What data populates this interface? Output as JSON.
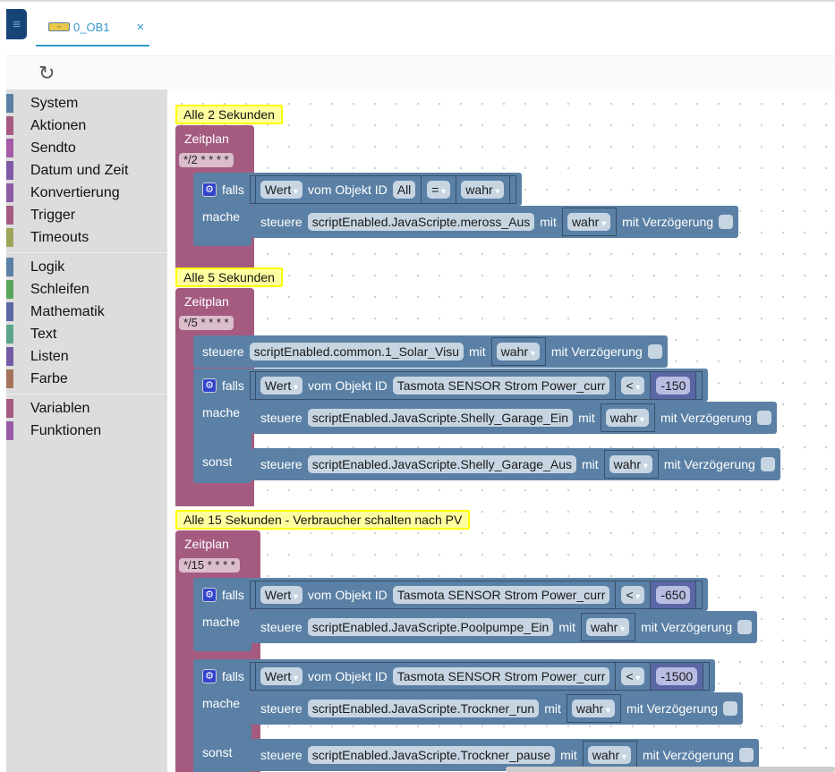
{
  "tab": {
    "label": "0_OB1",
    "close": "×",
    "icon": "script-block-icon"
  },
  "toolbar": {
    "refresh_icon": "refresh-icon"
  },
  "menu_icon": "hamburger-icon",
  "sidebar": {
    "groups": [
      [
        {
          "label": "System",
          "color": "#5b80a5"
        },
        {
          "label": "Aktionen",
          "color": "#a55b80"
        },
        {
          "label": "Sendto",
          "color": "#a55ba5"
        },
        {
          "label": "Datum und Zeit",
          "color": "#805ba5"
        },
        {
          "label": "Konvertierung",
          "color": "#8e5ba5"
        },
        {
          "label": "Trigger",
          "color": "#a55b80"
        },
        {
          "label": "Timeouts",
          "color": "#9fa55b"
        }
      ],
      [
        {
          "label": "Logik",
          "color": "#5b80a5"
        },
        {
          "label": "Schleifen",
          "color": "#5ba55b"
        },
        {
          "label": "Mathematik",
          "color": "#5b67a5"
        },
        {
          "label": "Text",
          "color": "#5ba58c"
        },
        {
          "label": "Listen",
          "color": "#745ba5"
        },
        {
          "label": "Farbe",
          "color": "#a5745b"
        }
      ],
      [
        {
          "label": "Variablen",
          "color": "#a55b80"
        },
        {
          "label": "Funktionen",
          "color": "#995ba5"
        }
      ]
    ]
  },
  "labels": {
    "schedule": "Zeitplan",
    "if": "falls",
    "do": "mache",
    "else": "sonst",
    "control": "steuere",
    "with": "mit",
    "delay": "mit Verzögerung",
    "value": "Wert",
    "from_object": "vom Objekt ID"
  },
  "scripts": [
    {
      "comment": "Alle 2 Sekunden",
      "cron": "*/2 * * * *",
      "statements": [
        {
          "type": "if",
          "cond": {
            "object": "All",
            "op": "=",
            "value": "wahr",
            "value_type": "bool"
          },
          "do": {
            "object": "scriptEnabled.JavaScripte.meross_Aus",
            "value": "wahr"
          }
        }
      ]
    },
    {
      "comment": "Alle 5 Sekunden",
      "cron": "*/5 * * * *",
      "statements": [
        {
          "type": "control",
          "object": "scriptEnabled.common.1_Solar_Visu",
          "value": "wahr"
        },
        {
          "type": "if",
          "cond": {
            "object": "Tasmota SENSOR Strom  Power_curr",
            "op": "<",
            "value": "-150",
            "value_type": "number"
          },
          "do": {
            "object": "scriptEnabled.JavaScripte.Shelly_Garage_Ein",
            "value": "wahr"
          },
          "else": {
            "object": "scriptEnabled.JavaScripte.Shelly_Garage_Aus",
            "value": "wahr"
          }
        }
      ]
    },
    {
      "comment": "Alle 15 Sekunden - Verbraucher schalten nach PV",
      "cron": "*/15 * * * *",
      "statements": [
        {
          "type": "if",
          "cond": {
            "object": "Tasmota SENSOR Strom  Power_curr",
            "op": "<",
            "value": "-650",
            "value_type": "number"
          },
          "do": {
            "object": "scriptEnabled.JavaScripte.Poolpumpe_Ein",
            "value": "wahr"
          }
        },
        {
          "type": "if",
          "cond": {
            "object": "Tasmota SENSOR Strom  Power_curr",
            "op": "<",
            "value": "-1500",
            "value_type": "number"
          },
          "do": {
            "object": "scriptEnabled.JavaScripte.Trockner_run",
            "value": "wahr"
          },
          "else": {
            "object": "scriptEnabled.JavaScripte.Trockner_pause",
            "value": "wahr"
          }
        }
      ]
    }
  ]
}
